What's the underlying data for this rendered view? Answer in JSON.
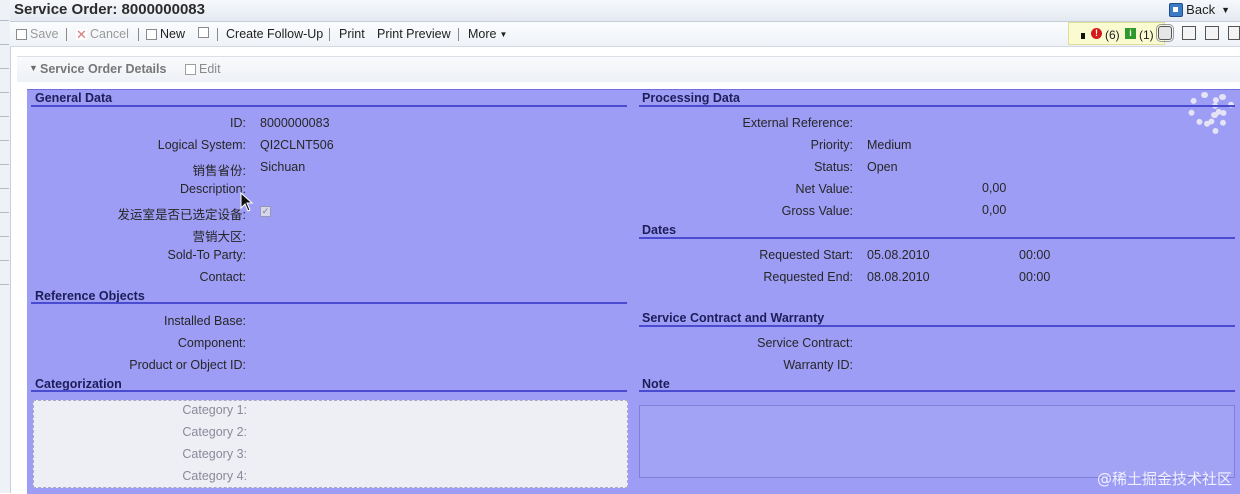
{
  "window": {
    "title": "Service Order: 8000000083",
    "back_label": "Back"
  },
  "toolbar": {
    "save": "Save",
    "cancel": "Cancel",
    "new": "New",
    "create_followup": "Create Follow-Up",
    "print": "Print",
    "print_preview": "Print Preview",
    "more": "More",
    "messages": {
      "errors": "(6)",
      "infos": "(1)"
    }
  },
  "panel": {
    "title": "Service Order Details",
    "edit": "Edit"
  },
  "general": {
    "header": "General Data",
    "fields": [
      {
        "label": "ID:",
        "value": "8000000083"
      },
      {
        "label": "Logical System:",
        "value": "QI2CLNT506"
      },
      {
        "label": "销售省份:",
        "value": "Sichuan"
      },
      {
        "label": "Description:",
        "value": ""
      },
      {
        "label": "发运室是否已选定设备:",
        "value": ""
      },
      {
        "label": "营销大区:",
        "value": ""
      },
      {
        "label": "Sold-To Party:",
        "value": ""
      },
      {
        "label": "Contact:",
        "value": ""
      }
    ]
  },
  "reference": {
    "header": "Reference Objects",
    "fields": [
      {
        "label": "Installed Base:",
        "value": ""
      },
      {
        "label": "Component:",
        "value": ""
      },
      {
        "label": "Product or Object ID:",
        "value": ""
      }
    ]
  },
  "categorization": {
    "header": "Categorization",
    "fields": [
      {
        "label": "Category 1:"
      },
      {
        "label": "Category 2:"
      },
      {
        "label": "Category 3:"
      },
      {
        "label": "Category 4:"
      }
    ]
  },
  "processing": {
    "header": "Processing Data",
    "fields": [
      {
        "label": "External Reference:",
        "value": ""
      },
      {
        "label": "Priority:",
        "value": "Medium"
      },
      {
        "label": "Status:",
        "value": "Open"
      },
      {
        "label": "Net Value:",
        "value": "0,00"
      },
      {
        "label": "Gross Value:",
        "value": "0,00"
      }
    ]
  },
  "dates": {
    "header": "Dates",
    "fields": [
      {
        "label": "Requested Start:",
        "date": "05.08.2010",
        "time": "00:00"
      },
      {
        "label": "Requested End:",
        "date": "08.08.2010",
        "time": "00:00"
      }
    ]
  },
  "contract": {
    "header": "Service Contract and Warranty",
    "fields": [
      {
        "label": "Service Contract:",
        "value": ""
      },
      {
        "label": "Warranty ID:",
        "value": ""
      }
    ]
  },
  "note": {
    "header": "Note"
  },
  "watermark": "@稀土掘金技术社区"
}
